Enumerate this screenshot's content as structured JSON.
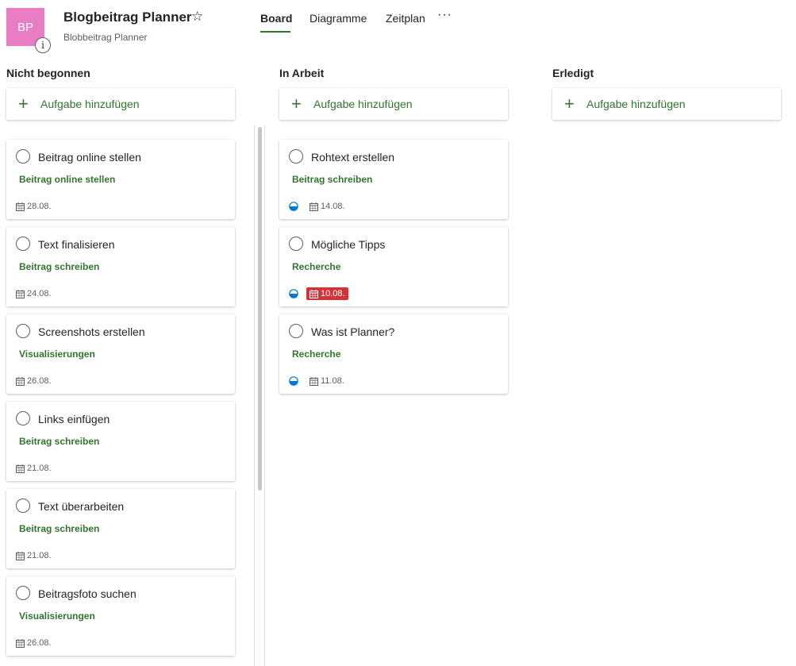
{
  "plan": {
    "avatar": "BP",
    "info_glyph": "i",
    "title": "Blogbeitrag Planner",
    "star": "☆",
    "subtitle": "Blobbeitrag Planner"
  },
  "tabs": [
    {
      "label": "Board",
      "active": true
    },
    {
      "label": "Diagramme",
      "active": false
    },
    {
      "label": "Zeitplan",
      "active": false
    }
  ],
  "more_label": "···",
  "add_task_plus": "+",
  "colors": {
    "accent": "#31752f",
    "overdue": "#d13438",
    "avatar": "#e87dc4",
    "progress": "#0078d4"
  },
  "columns": [
    {
      "title": "Nicht begonnen",
      "add_label": "Aufgabe hinzufügen",
      "cards": [
        {
          "title": "Beitrag online stellen",
          "bucket": "Beitrag online stellen",
          "date": "28.08."
        },
        {
          "title": "Text finalisieren",
          "bucket": "Beitrag schreiben",
          "date": "24.08."
        },
        {
          "title": "Screenshots erstellen",
          "bucket": "Visualisierungen",
          "date": "26.08."
        },
        {
          "title": "Links einfügen",
          "bucket": "Beitrag schreiben",
          "date": "21.08."
        },
        {
          "title": "Text überarbeiten",
          "bucket": "Beitrag schreiben",
          "date": "21.08."
        },
        {
          "title": "Beitragsfoto suchen",
          "bucket": "Visualisierungen",
          "date": "26.08."
        }
      ]
    },
    {
      "title": "In Arbeit",
      "add_label": "Aufgabe hinzufügen",
      "cards": [
        {
          "title": "Rohtext erstellen",
          "bucket": "Beitrag schreiben",
          "date": "14.08.",
          "progress": "in-progress"
        },
        {
          "title": "Mögliche Tipps",
          "bucket": "Recherche",
          "date": "10.08.",
          "progress": "in-progress",
          "overdue": true
        },
        {
          "title": "Was ist Planner?",
          "bucket": "Recherche",
          "date": "11.08.",
          "progress": "in-progress"
        }
      ]
    },
    {
      "title": "Erledigt",
      "add_label": "Aufgabe hinzufügen",
      "cards": []
    }
  ]
}
